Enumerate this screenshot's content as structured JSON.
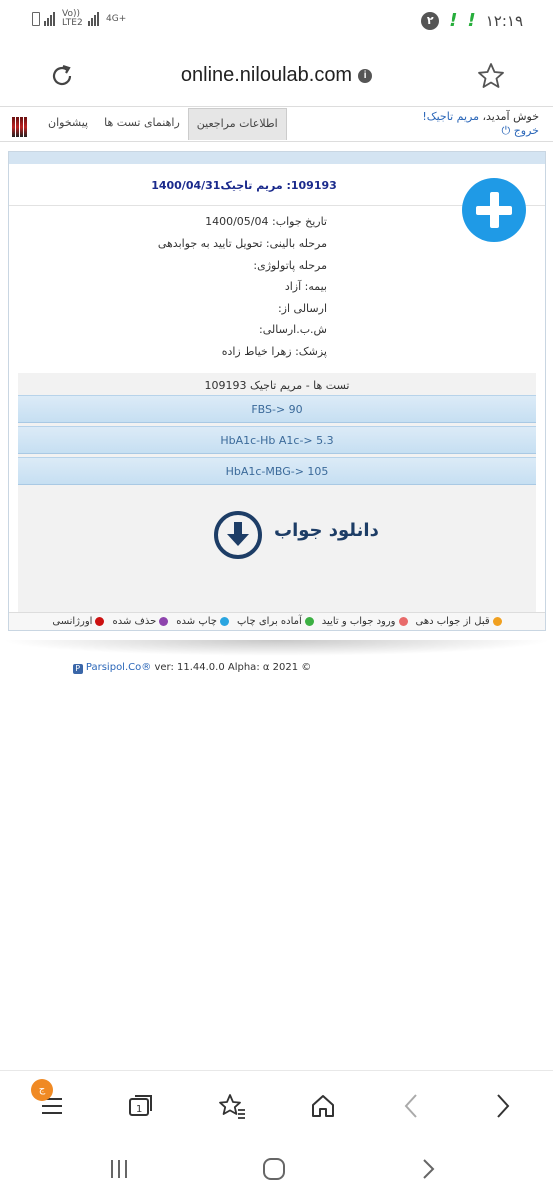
{
  "status_bar": {
    "carrier_label": "Vo)) LTE2",
    "network_label": "4G+",
    "notification_count": "۲",
    "time": "۱۲:۱۹"
  },
  "browser": {
    "url": "online.niloulab.com",
    "info_icon": "i"
  },
  "site_nav": {
    "welcome_prefix": "خوش آمدید،",
    "user_name": "مریم تاجیک!",
    "logout_label": "خروج",
    "tabs": [
      {
        "label": "اطلاعات مراجعین",
        "active": true
      },
      {
        "label": "راهنمای تست ها",
        "active": false
      },
      {
        "label": "پیشخوان",
        "active": false
      }
    ]
  },
  "record": {
    "title": "109193: مریم تاجیک1400/04/31",
    "info_lines": [
      "تاریخ جواب: 1400/05/04",
      "مرحله بالینی: تحویل تایید به جوابدهی",
      "مرحله پاتولوژی:",
      "بیمه: آزاد",
      "ارسالی از:",
      "ش.ب.ارسالی:",
      "پزشک: زهرا خیاط زاده"
    ]
  },
  "tests": {
    "header": "تست ها - مریم تاجیک 109193",
    "items": [
      "FBS-> 90",
      "HbA1c-Hb A1c-> 5.3",
      "HbA1c-MBG-> 105"
    ],
    "download_label": "دانلود جواب"
  },
  "legend": [
    {
      "label": "قبل از جواب دهی",
      "color": "#f0a020"
    },
    {
      "label": "ورود جواب و تایید",
      "color": "#e86a6a"
    },
    {
      "label": "آماده برای چاپ",
      "color": "#3cb043"
    },
    {
      "label": "چاپ شده",
      "color": "#2aa5e0"
    },
    {
      "label": "حذف شده",
      "color": "#8e44ad"
    },
    {
      "label": "اورژانسی",
      "color": "#cc1111"
    }
  ],
  "footer": {
    "brand": "Parsipol.Co®",
    "version": "ver: 11.44.0.0 Alpha: α 2021 ©"
  },
  "toolbar": {
    "menu_badge": "ج"
  }
}
